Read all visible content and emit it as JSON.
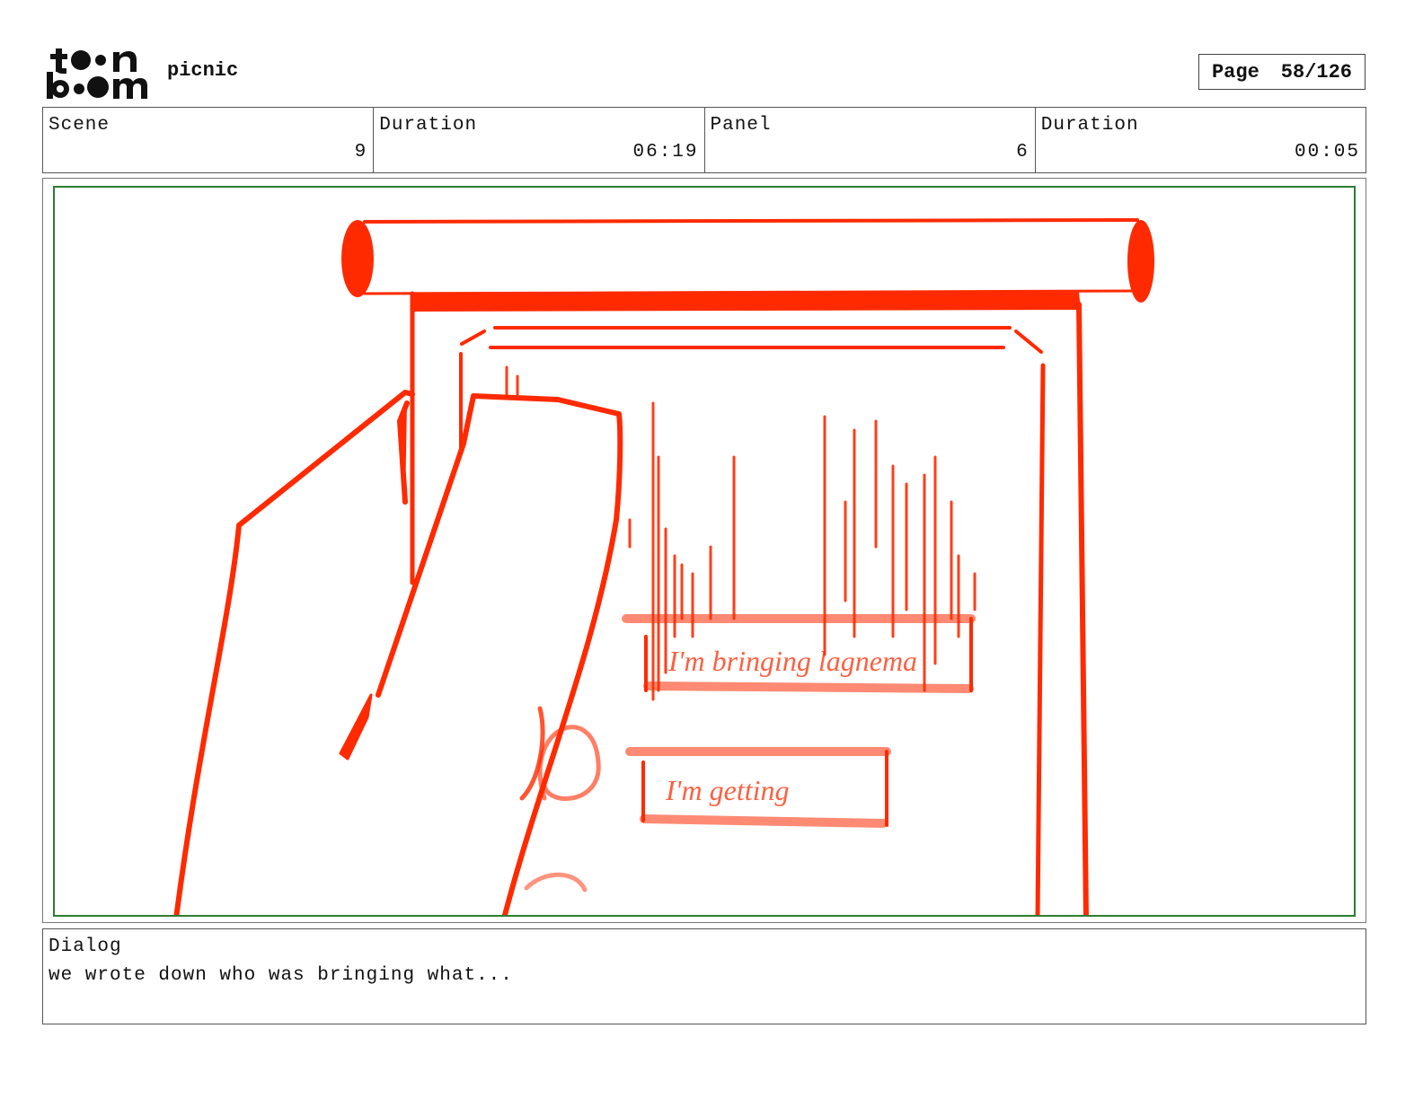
{
  "header": {
    "logo_text": "toon boom",
    "project": "picnic",
    "page_label": "Page",
    "page_value": "58/126"
  },
  "info": {
    "scene_label": "Scene",
    "scene_value": "9",
    "scene_duration_label": "Duration",
    "scene_duration_value": "06:19",
    "panel_label": "Panel",
    "panel_value": "6",
    "panel_duration_label": "Duration",
    "panel_duration_value": "00:05"
  },
  "sketch": {
    "line_color": "#ff2a00",
    "frame_color": "#2e7d32",
    "note_1": "I'm bringing lagnema",
    "note_2": "I'm getting"
  },
  "dialog": {
    "label": "Dialog",
    "text": "we wrote down who was bringing what..."
  }
}
